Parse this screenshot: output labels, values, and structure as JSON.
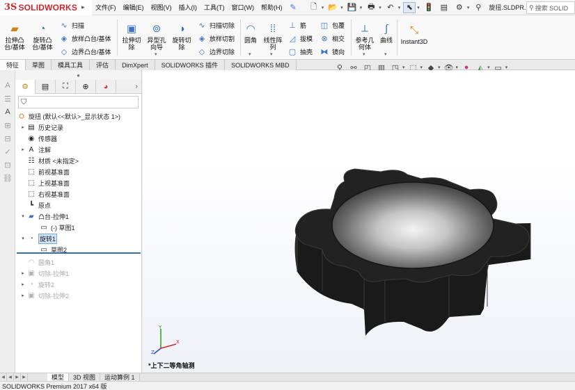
{
  "app": {
    "logo_ds": "3S",
    "logo_text": "SOLIDWORKS",
    "menus": [
      "文件(F)",
      "编辑(E)",
      "视图(V)",
      "插入(I)",
      "工具(T)",
      "窗口(W)",
      "帮助(H)"
    ],
    "doc_title": "旋扭.SLDPR...",
    "search_placeholder": "搜索 SOLID"
  },
  "ribbon": {
    "extrude_boss": "拉伸凸\n台/基体",
    "revolve_boss": "旋转凸\n台/基体",
    "sweep": "扫描",
    "loft_boss": "放样凸台/基体",
    "boundary_boss": "边界凸台/基体",
    "extrude_cut": "拉伸切\n除",
    "hole_wizard": "异型孔\n向导",
    "revolve_cut": "旋转切\n除",
    "swept_cut": "扫描切除",
    "lofted_cut": "放样切割",
    "boundary_cut": "边界切除",
    "fillet": "圆角",
    "linear_pattern": "线性阵\n列",
    "rib": "筋",
    "draft": "拔模",
    "shell": "抽壳",
    "wrap": "包覆",
    "intersect": "相交",
    "mirror": "镜向",
    "ref_geometry": "参考几\n何体",
    "curves": "曲线",
    "instant3d": "Instant3D"
  },
  "cm_tabs": [
    "特征",
    "草图",
    "模具工具",
    "评估",
    "DimXpert",
    "SOLIDWORKS 插件",
    "SOLIDWORKS MBD"
  ],
  "tree": {
    "root": "旋扭  (默认<<默认>_显示状态 1>)",
    "nodes": [
      {
        "label": "历史记录"
      },
      {
        "label": "传感器"
      },
      {
        "label": "注解"
      },
      {
        "label": "材质 <未指定>"
      },
      {
        "label": "前视基准面"
      },
      {
        "label": "上视基准面"
      },
      {
        "label": "右视基准面"
      },
      {
        "label": "原点"
      },
      {
        "label": "凸台-拉伸1"
      },
      {
        "label": "(-) 草图1"
      },
      {
        "label": "旋转1"
      },
      {
        "label": "草图2"
      },
      {
        "label": "圆角1"
      },
      {
        "label": "切除-拉伸1"
      },
      {
        "label": "旋转2"
      },
      {
        "label": "切除-拉伸2"
      }
    ]
  },
  "viewport": {
    "view_label": "*上下二等角轴测"
  },
  "bottom_tabs": [
    "模型",
    "3D 视图",
    "运动算例 1"
  ],
  "status": "SOLIDWORKS Premium 2017 x64 版",
  "colors": {
    "brand_red": "#d2232a",
    "selection": "#cfe3f8",
    "rollback_bar": "#2f6fb8",
    "part_body": "#1e1e1e"
  }
}
